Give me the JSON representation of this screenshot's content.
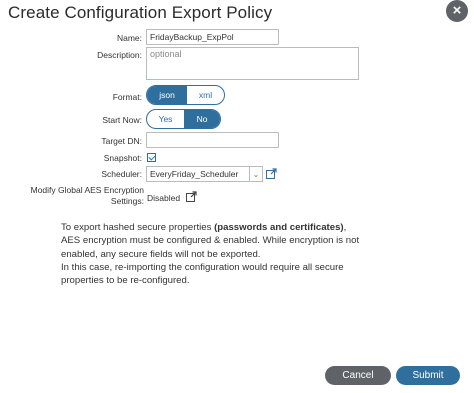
{
  "dialog": {
    "title": "Create Configuration Export Policy",
    "close_glyph": "×"
  },
  "form": {
    "name_label": "Name:",
    "name_value": "FridayBackup_ExpPol",
    "description_label": "Description:",
    "description_placeholder": "optional",
    "format_label": "Format:",
    "format_options": [
      "json",
      "xml"
    ],
    "format_selected": "json",
    "start_now_label": "Start Now:",
    "start_now_options": [
      "Yes",
      "No"
    ],
    "start_now_selected": "No",
    "target_dn_label": "Target DN:",
    "target_dn_value": "",
    "snapshot_label": "Snapshot:",
    "snapshot_checked": true,
    "scheduler_label": "Scheduler:",
    "scheduler_value": "EveryFriday_Scheduler",
    "aes_label": "Modify Global AES Encryption Settings:",
    "aes_value": "Disabled"
  },
  "note": {
    "line1_pre": "To export hashed secure properties ",
    "line1_bold": "(passwords and certificates)",
    "line1_post": ", AES encryption must be configured & enabled. While encryption is not enabled, any secure fields will not be exported.",
    "line2": "In this case, re-importing the configuration would require all secure properties to be re-configured."
  },
  "buttons": {
    "cancel": "Cancel",
    "submit": "Submit"
  },
  "colors": {
    "accent": "#2f6f9e",
    "secondary_button": "#5f6367"
  },
  "icons": {
    "close": "close-icon",
    "scheduler_dropdown": "chevron-down-icon",
    "scheduler_link": "open-external-icon",
    "aes_link": "open-external-icon"
  }
}
